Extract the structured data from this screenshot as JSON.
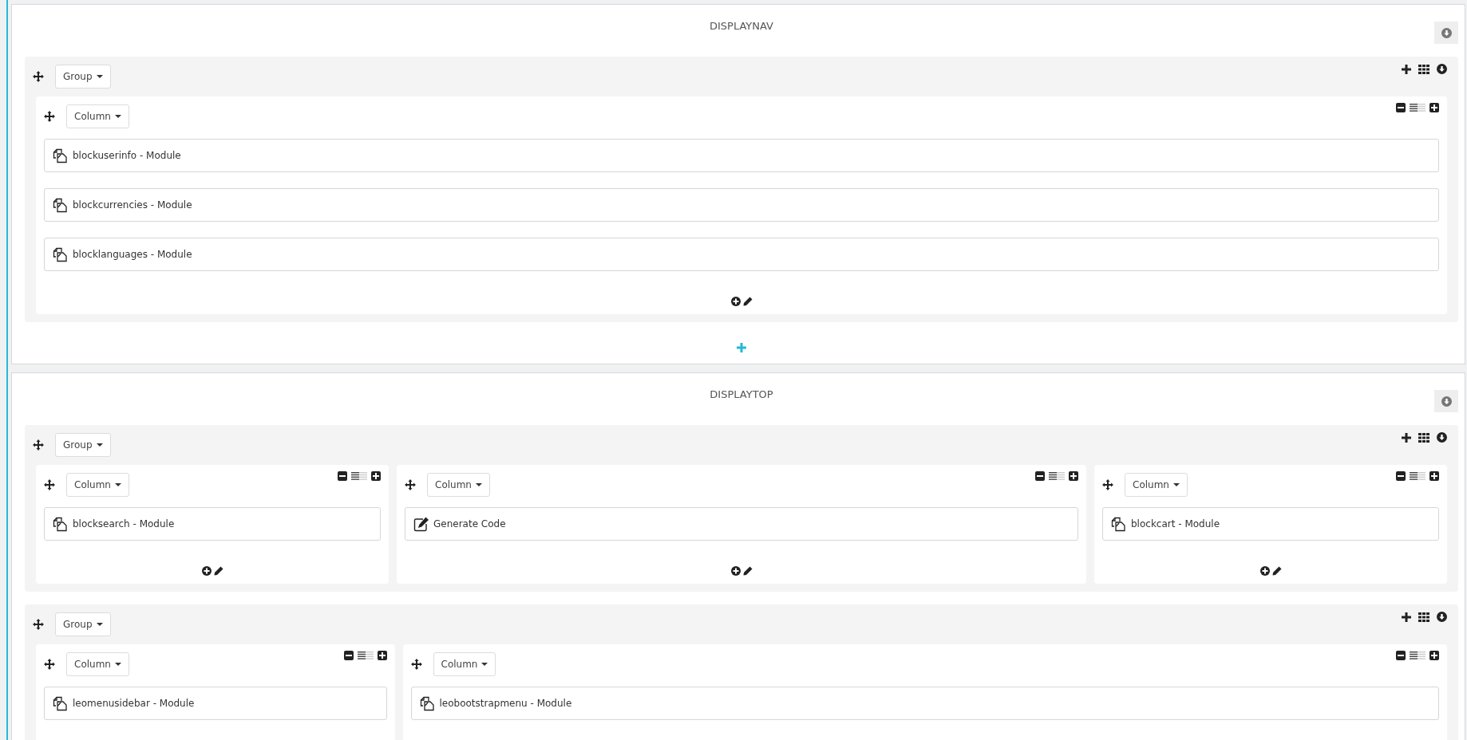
{
  "sections": [
    {
      "title": "DISPLAYNAV",
      "groups": [
        {
          "label": "Group",
          "columns": [
            {
              "label": "Column",
              "items": [
                {
                  "kind": "module",
                  "text": "blockuserinfo - Module"
                },
                {
                  "kind": "module",
                  "text": "blockcurrencies - Module"
                },
                {
                  "kind": "module",
                  "text": "blocklanguages - Module"
                }
              ]
            }
          ]
        }
      ]
    },
    {
      "title": "DISPLAYTOP",
      "groups": [
        {
          "label": "Group",
          "columns": [
            {
              "label": "Column",
              "items": [
                {
                  "kind": "module",
                  "text": "blocksearch - Module"
                }
              ]
            },
            {
              "label": "Column",
              "items": [
                {
                  "kind": "code",
                  "text": "Generate Code"
                }
              ]
            },
            {
              "label": "Column",
              "items": [
                {
                  "kind": "module",
                  "text": "blockcart - Module"
                }
              ]
            }
          ]
        },
        {
          "label": "Group",
          "columns": [
            {
              "label": "Column",
              "items": [
                {
                  "kind": "module",
                  "text": "leomenusidebar - Module"
                }
              ]
            },
            {
              "label": "Column",
              "items": [
                {
                  "kind": "module",
                  "text": "leobootstrapmenu - Module"
                }
              ]
            }
          ]
        }
      ]
    }
  ]
}
